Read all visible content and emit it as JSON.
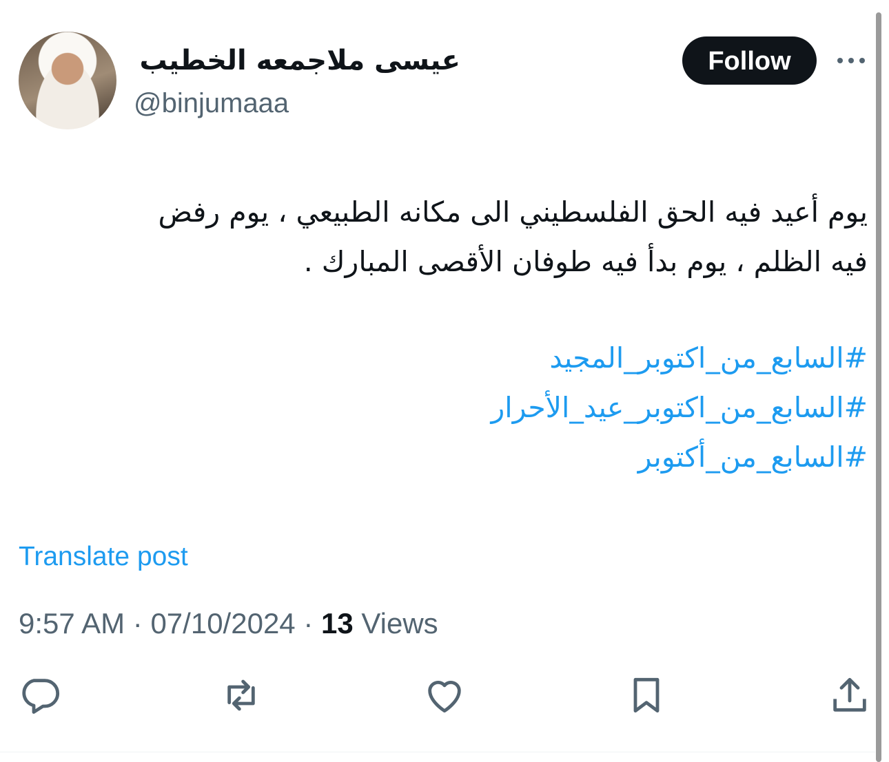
{
  "author": {
    "display_name": "عيسى ملاجمعه الخطيب",
    "handle": "@binjumaaa"
  },
  "follow_label": "Follow",
  "post": {
    "text": "يوم أعيد فيه الحق الفلسطيني الى مكانه الطبيعي ، يوم رفض\nفيه الظلم ، يوم بدأ فيه طوفان الأقصى المبارك .",
    "hashtags": [
      "#السابع_من_اكتوبر_المجيد",
      "#السابع_من_اكتوبر_عيد_الأحرار",
      "#السابع_من_أكتوبر"
    ],
    "translate_label": "Translate post",
    "time": "9:57 AM",
    "separator": "·",
    "date": "07/10/2024",
    "views_count": "13",
    "views_label": "Views"
  },
  "actions": [
    {
      "name": "reply",
      "icon": "reply-icon"
    },
    {
      "name": "repost",
      "icon": "repost-icon"
    },
    {
      "name": "like",
      "icon": "like-icon"
    },
    {
      "name": "bookmark",
      "icon": "bookmark-icon"
    },
    {
      "name": "share",
      "icon": "share-icon"
    }
  ],
  "colors": {
    "link": "#1d9bf0",
    "secondary_text": "#536471",
    "primary_text": "#0f1419",
    "follow_bg": "#0f1419"
  }
}
